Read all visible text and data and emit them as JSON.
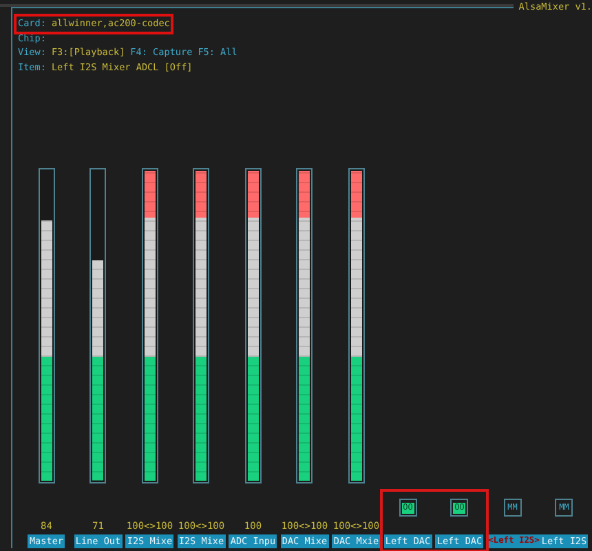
{
  "window": {
    "title": "AlsaMixer v1."
  },
  "header": {
    "card": {
      "label": "Card:",
      "value": "allwinner,ac200-codec",
      "highlighted": true
    },
    "chip": {
      "label": "Chip:"
    },
    "view": {
      "label": "View:",
      "tabs": [
        {
          "label": "F3:[Playback]",
          "selected": true
        },
        {
          "label": "F4: Capture",
          "selected": false
        },
        {
          "label": "F5: All",
          "selected": false
        }
      ]
    },
    "item": {
      "label": "Item:",
      "value": "Left I2S Mixer ADCL [Off]"
    }
  },
  "controls": [
    {
      "kind": "slider",
      "label": "Master",
      "reading": "84",
      "level": 0.84,
      "selected": false,
      "highlighted": false
    },
    {
      "kind": "slider",
      "label": "Line Out",
      "reading": "71",
      "level": 0.71,
      "selected": false,
      "highlighted": false
    },
    {
      "kind": "slider",
      "label": "I2S Mixe",
      "reading": "100<>100",
      "level": 1,
      "selected": false,
      "highlighted": false
    },
    {
      "kind": "slider",
      "label": "I2S Mixe",
      "reading": "100<>100",
      "level": 1,
      "selected": false,
      "highlighted": false
    },
    {
      "kind": "slider",
      "label": "ADC Inpu",
      "reading": "100",
      "level": 1,
      "selected": false,
      "highlighted": false
    },
    {
      "kind": "slider",
      "label": "DAC Mixe",
      "reading": "100<>100",
      "level": 1,
      "selected": false,
      "highlighted": false
    },
    {
      "kind": "slider",
      "label": "DAC Mxie",
      "reading": "100<>100",
      "level": 1,
      "selected": false,
      "highlighted": false
    },
    {
      "kind": "switch",
      "label": "Left DAC",
      "switch_text": "OO",
      "on": true,
      "selected": false,
      "highlighted": true
    },
    {
      "kind": "switch",
      "label": "Left DAC",
      "switch_text": "OO",
      "on": true,
      "selected": false,
      "highlighted": true
    },
    {
      "kind": "switch",
      "label": "<Left I2S>",
      "switch_text": "MM",
      "on": false,
      "selected": true,
      "highlighted": false
    },
    {
      "kind": "switch",
      "label": "Left I2S",
      "switch_text": "MM",
      "on": false,
      "selected": false,
      "highlighted": false
    }
  ]
}
